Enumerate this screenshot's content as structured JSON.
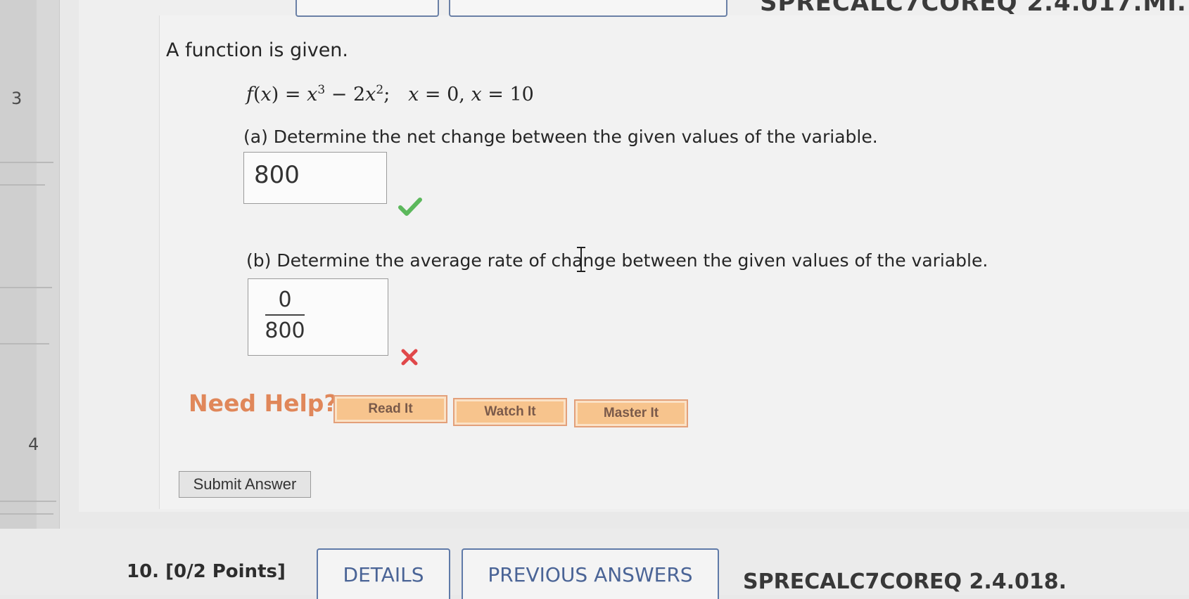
{
  "top": {
    "code": "SPRECALC7COREQ 2.4.017.MI."
  },
  "gutter": {
    "prev_question_number": "3",
    "next_question_number": "4"
  },
  "question": {
    "prompt": "A function is given.",
    "function_display": "f(x) = x3 − 2x2;   x = 0, x = 10",
    "part_a": {
      "label": "(a) Determine the net change between the given values of the variable.",
      "answer": "800",
      "status": "correct",
      "status_color": "#5cb85c"
    },
    "part_b": {
      "label": "(b) Determine the average rate of change between the given values of the variable.",
      "answer_numerator": "0",
      "answer_denominator": "800",
      "status": "incorrect",
      "status_color": "#e0484a"
    }
  },
  "help": {
    "label": "Need Help?",
    "buttons": [
      "Read It",
      "Watch It",
      "Master It"
    ],
    "accent": "#e0875a"
  },
  "submit_label": "Submit Answer",
  "next_question": {
    "label": "10.  [0/2 Points]",
    "tabs": [
      "DETAILS",
      "PREVIOUS ANSWERS"
    ],
    "code": "SPRECALC7COREQ 2.4.018."
  }
}
